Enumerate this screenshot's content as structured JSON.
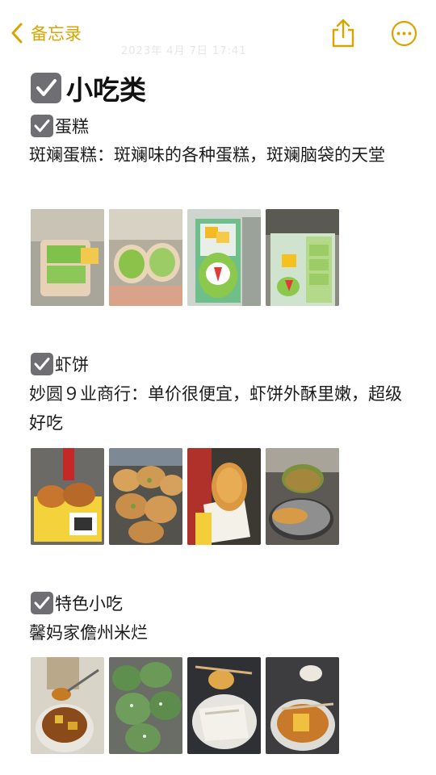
{
  "nav": {
    "back_label": "备忘录",
    "date": "2023年 4月 7日 17:41"
  },
  "note": {
    "title": "小吃类",
    "sections": [
      {
        "title": "蛋糕",
        "body": "斑斓蛋糕：斑斓味的各种蛋糕，斑斓脑袋的天堂",
        "photos": [
          "cake-photo-1",
          "cake-photo-2",
          "cake-photo-3",
          "cake-photo-4"
        ]
      },
      {
        "title": "虾饼",
        "body": "妙圆９业商行：单价很便宜，虾饼外酥里嫩，超级好吃",
        "photos": [
          "shrimp-cake-photo-1",
          "shrimp-cake-photo-2",
          "shrimp-cake-photo-3",
          "shrimp-cake-photo-4"
        ]
      },
      {
        "title": "特色小吃",
        "body": "馨妈家儋州米烂",
        "photos": [
          "snack-photo-1",
          "snack-photo-2",
          "snack-photo-3",
          "snack-photo-4"
        ]
      }
    ]
  },
  "colors": {
    "accent": "#d9a400",
    "checkbox": "#6e6e73",
    "text": "#1c1c1e"
  },
  "icons": {
    "back": "chevron-left-icon",
    "share": "share-icon",
    "more": "ellipsis-circle-icon",
    "check": "checkmark-icon"
  }
}
